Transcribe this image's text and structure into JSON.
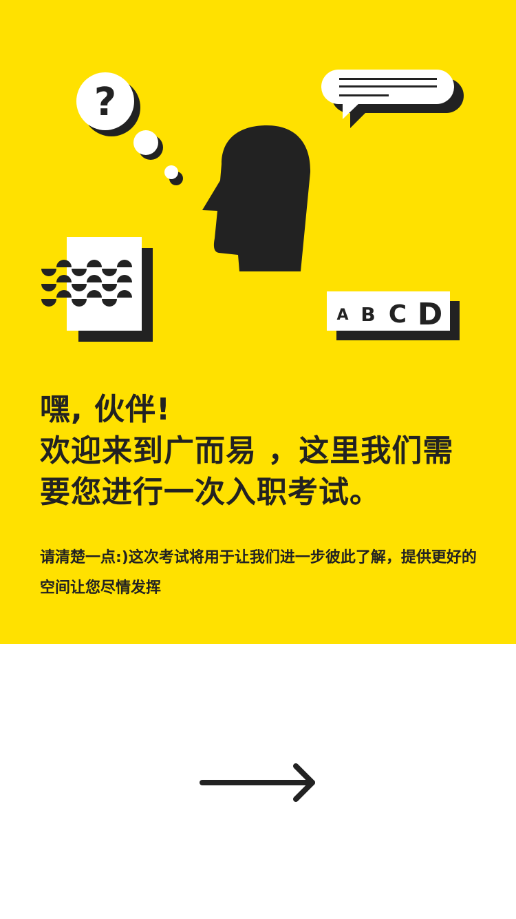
{
  "colors": {
    "accent": "#FFE100",
    "ink": "#222222",
    "background": "#FFFFFF"
  },
  "illustration": {
    "question_mark": "?",
    "options": [
      "A",
      "B",
      "C",
      "D"
    ]
  },
  "intro": {
    "title_lines": [
      "嘿, 伙伴!",
      "欢迎来到广而易 ，这里我们需",
      "要您进行一次入职考试。"
    ],
    "description": "请清楚一点:)这次考试将用于让我们进一步彼此了解，提供更好的空间让您尽情发挥"
  },
  "next_button": {
    "icon": "arrow-right-icon"
  }
}
